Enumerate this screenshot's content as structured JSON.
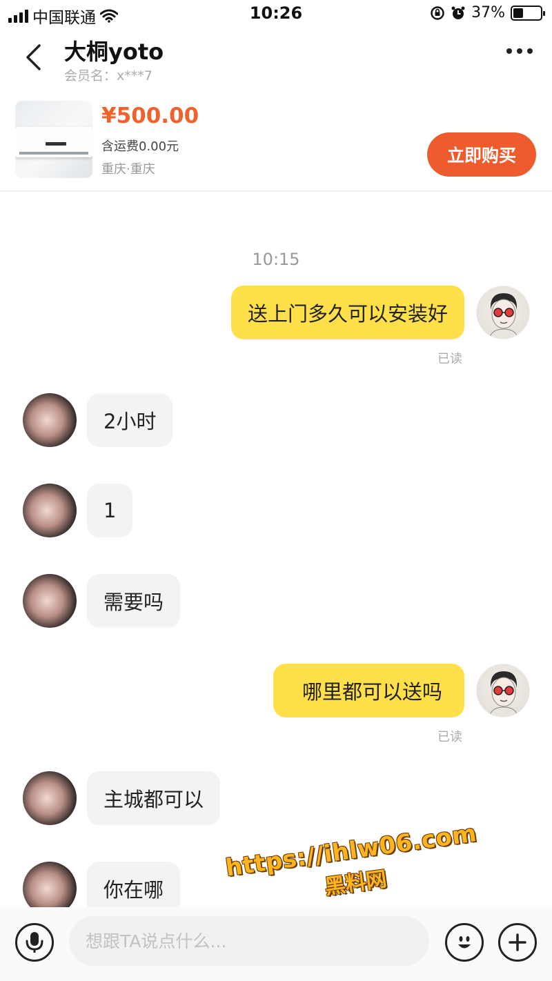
{
  "status_bar": {
    "carrier": "中国联通",
    "time": "10:26",
    "battery": "37%",
    "battery_level": 0.37
  },
  "header": {
    "seller_name": "大桐yoto",
    "member_id": "会员名：x***7"
  },
  "product": {
    "price": "¥500.00",
    "shipping": "含运费0.00元",
    "location": "重庆·重庆",
    "buy_label": "立即购买"
  },
  "chat": {
    "timestamp": "10:15",
    "messages": [
      {
        "from": "me",
        "text": "送上门多久可以安装好",
        "status": "已读"
      },
      {
        "from": "other",
        "text": "2小时"
      },
      {
        "from": "other",
        "text": "1"
      },
      {
        "from": "other",
        "text": "需要吗"
      },
      {
        "from": "me",
        "text": "哪里都可以送吗",
        "status": "已读"
      },
      {
        "from": "other",
        "text": "主城都可以"
      },
      {
        "from": "other",
        "text": "你在哪"
      }
    ]
  },
  "input": {
    "placeholder": "想跟TA说点什么..."
  },
  "watermark": {
    "url": "https://ihlw06.com",
    "name": "黑料网"
  },
  "colors": {
    "accent": "#ee5b2c",
    "price": "#f0612b",
    "my_bubble": "#ffe04a",
    "other_bubble": "#f3f3f5"
  }
}
